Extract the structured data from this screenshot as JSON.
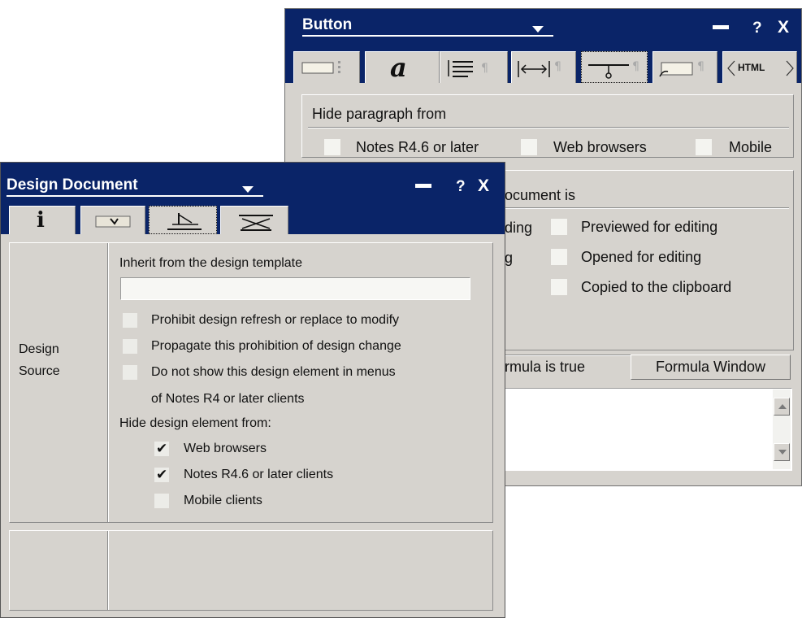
{
  "button_dialog": {
    "title": "Button",
    "tab_icons": [
      "field-info-icon",
      "font-icon",
      "paragraph-alignment-icon",
      "paragraph-margins-icon",
      "paragraph-hide-icon",
      "paragraph-styles-icon",
      "html-tags-icon"
    ],
    "html_tab_label": "HTML",
    "font_tab_label": "a",
    "hide_section_title": "Hide paragraph from",
    "hide_options": [
      "Notes R4.6 or later",
      "Web browsers",
      "Mobile"
    ],
    "doc_section_title_partial": "ocument is",
    "doc_options_left_partial": [
      "ding",
      "g"
    ],
    "doc_options": [
      "Previewed for editing",
      "Opened for editing",
      "Copied to the clipboard"
    ],
    "formula_label_partial": "rmula is true",
    "formula_button": "Formula Window"
  },
  "design_dialog": {
    "title": "Design Document",
    "tab_icons": [
      "info-icon",
      "tag-icon",
      "design-icon",
      "key-icon"
    ],
    "info_tab_label": "i",
    "section_label_line1": "Design",
    "section_label_line2": "Source",
    "inherit_label": "Inherit from the design template",
    "inherit_value": "",
    "prohibit_refresh": "Prohibit design refresh or replace to modify",
    "propagate": "Propagate this prohibition of design change",
    "hide_menus_line1": "Do not show this design element in menus",
    "hide_menus_line2": "of Notes R4 or later clients",
    "hide_from_label": "Hide design element from:",
    "hide_from_options": [
      {
        "label": "Web browsers",
        "checked": true
      },
      {
        "label": "Notes R4.6 or later clients",
        "checked": true
      },
      {
        "label": "Mobile clients",
        "checked": false
      }
    ],
    "check_mark": "✔"
  },
  "window_controls": {
    "help": "?",
    "close": "X"
  },
  "colors": {
    "titlebar": "#0a2468",
    "dialog_bg": "#d6d3ce"
  }
}
